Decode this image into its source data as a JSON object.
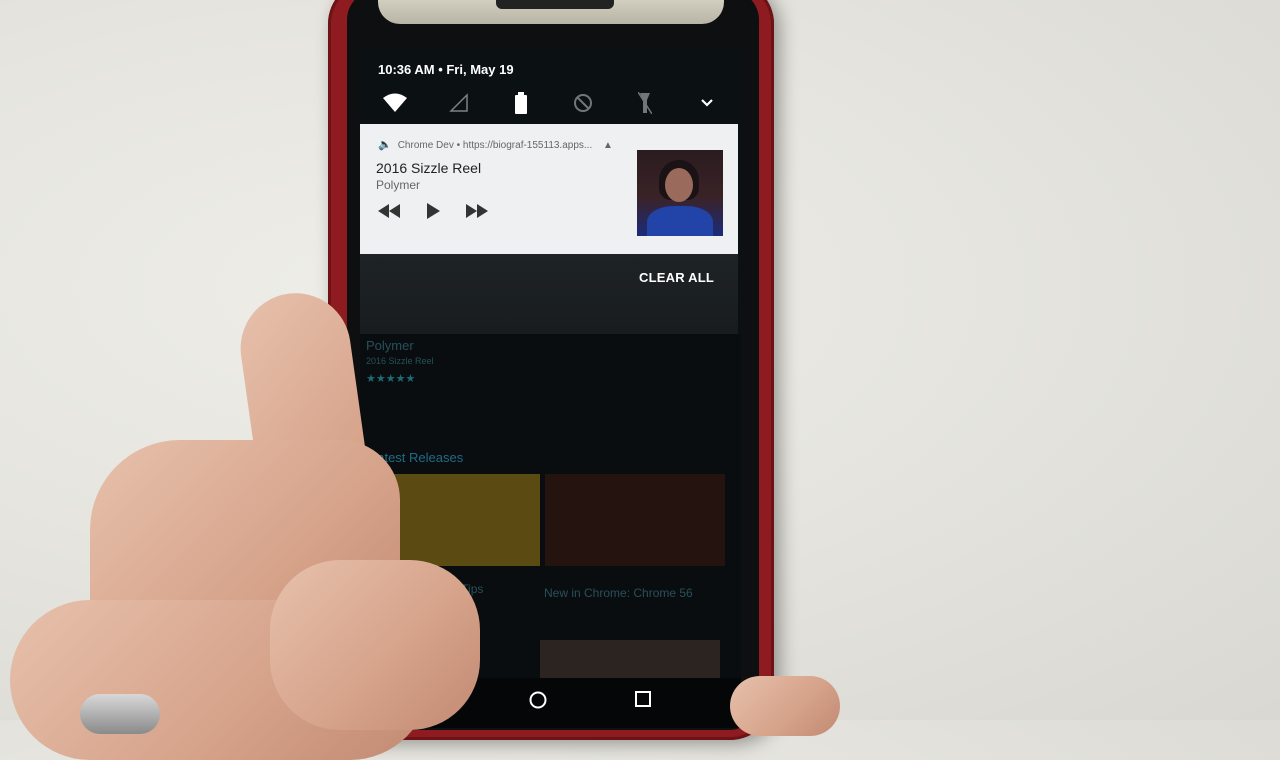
{
  "status_bar": {
    "time_date": "10:36 AM • Fri, May 19"
  },
  "quick_settings": [
    {
      "icon": "wifi-icon"
    },
    {
      "icon": "cellular-signal-icon"
    },
    {
      "icon": "battery-icon"
    },
    {
      "icon": "do-not-disturb-icon"
    },
    {
      "icon": "flashlight-icon"
    },
    {
      "icon": "chevron-down-icon"
    }
  ],
  "media_notification": {
    "source": "Chrome Dev • https://biograf-155113.apps...",
    "title": "2016 Sizzle Reel",
    "artist": "Polymer"
  },
  "notification_shade": {
    "clear_all_label": "CLEAR ALL"
  },
  "background_app": {
    "artist": "Polymer",
    "title": "2016 Sizzle Reel",
    "stars": "★★★★★",
    "section_heading": "Latest Releases",
    "tiles": [
      {
        "title": "Tooling Tips"
      },
      {
        "title": "New in Chrome: Chrome 56"
      }
    ]
  },
  "colors": {
    "case": "#8e1b1f",
    "notification_bg": "#eef0f2",
    "accent": "#27505a"
  }
}
